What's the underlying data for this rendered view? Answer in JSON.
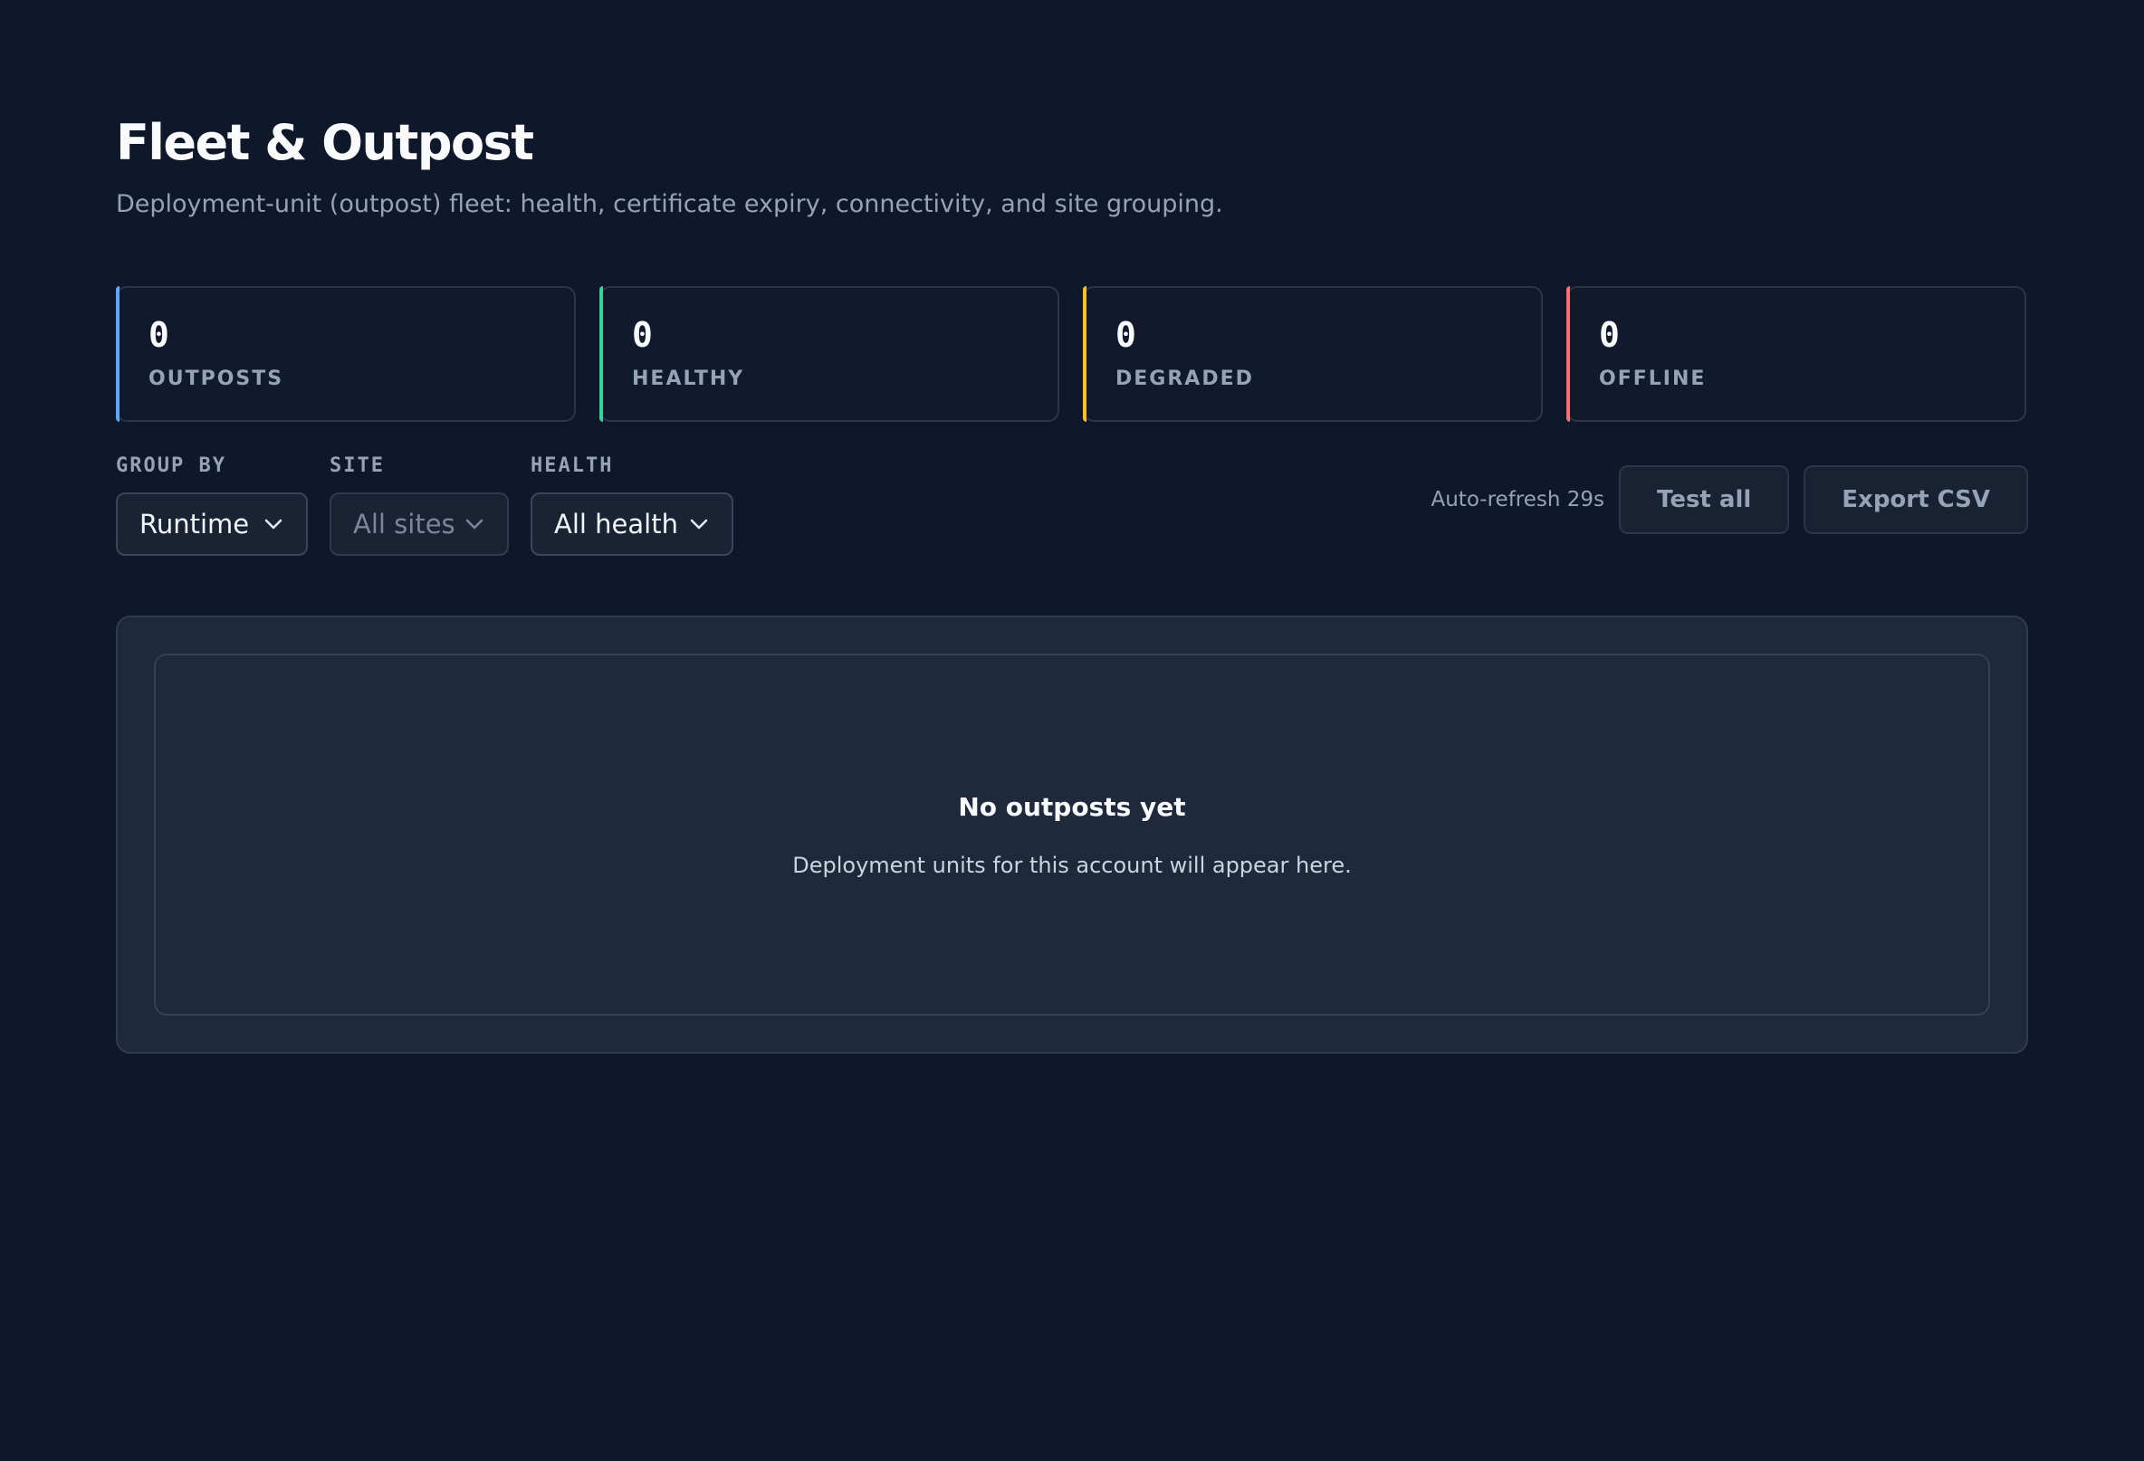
{
  "header": {
    "title": "Fleet & Outpost",
    "subtitle": "Deployment-unit (outpost) fleet: health, certificate expiry, connectivity, and site grouping."
  },
  "stats": [
    {
      "value": "0",
      "label": "OUTPOSTS",
      "accent": "#60a5fa"
    },
    {
      "value": "0",
      "label": "HEALTHY",
      "accent": "#34d399"
    },
    {
      "value": "0",
      "label": "DEGRADED",
      "accent": "#fbbf24"
    },
    {
      "value": "0",
      "label": "OFFLINE",
      "accent": "#f87171"
    }
  ],
  "filters": {
    "group_by": {
      "label": "GROUP BY",
      "value": "Runtime"
    },
    "site": {
      "label": "SITE",
      "value": "All sites"
    },
    "health": {
      "label": "HEALTH",
      "value": "All health"
    }
  },
  "actions": {
    "auto_refresh": "Auto-refresh 29s",
    "test_all": "Test all",
    "export_csv": "Export CSV"
  },
  "empty_state": {
    "title": "No outposts yet",
    "text": "Deployment units for this account will appear here."
  },
  "icons": {
    "dropdown": "chevron-down-icon"
  }
}
